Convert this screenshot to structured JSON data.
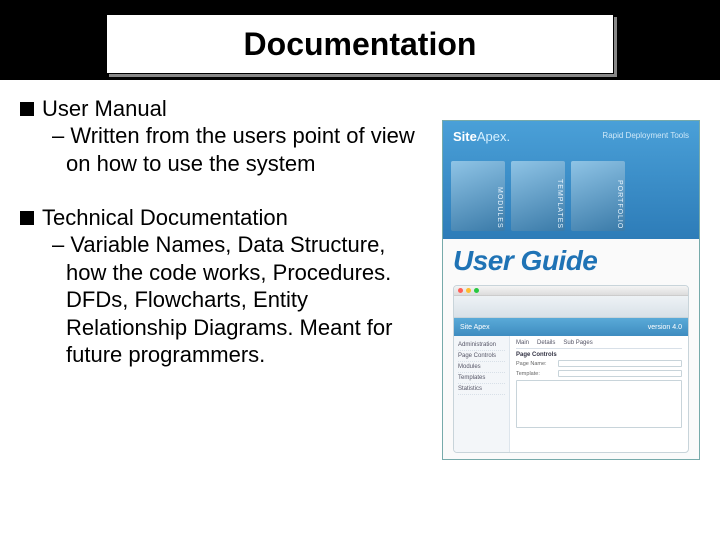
{
  "title": "Documentation",
  "bullets": [
    {
      "heading": "User Manual",
      "sub": "Written from the users point of view on how to use the system"
    },
    {
      "heading": "Technical Documentation",
      "sub": "Variable Names, Data Structure, how the code works, Procedures. DFDs, Flowcharts, Entity Relationship Diagrams. Meant for future programmers."
    }
  ],
  "guide": {
    "brand_a": "Site",
    "brand_b": "Apex.",
    "tagline": "Rapid Deployment Tools",
    "bars": [
      "MODULES",
      "TEMPLATES",
      "PORTFOLIO"
    ],
    "title": "User Guide",
    "app_brand": "Site Apex",
    "app_version": "version 4.0",
    "side_items": [
      "Administration",
      "Page Controls",
      "Modules",
      "Templates",
      "Statistics"
    ],
    "tabs": [
      "Main",
      "Details",
      "Sub Pages"
    ],
    "section_page": "Page Controls",
    "label_name": "Page Name:",
    "label_template": "Template:"
  }
}
